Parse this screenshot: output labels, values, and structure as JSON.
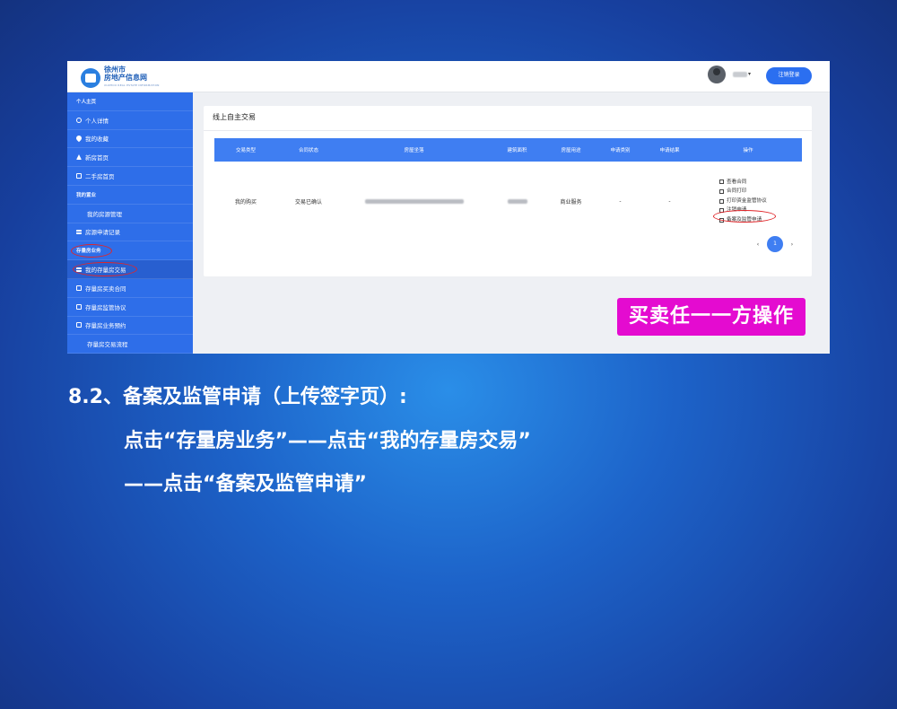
{
  "header": {
    "logo_line1": "徐州市",
    "logo_line2": "房地产信息网",
    "logo_line3": "XUZHOU REAL ESTATE INFORMATION",
    "logout_label": "注销登录"
  },
  "sidebar": {
    "items": [
      {
        "label": "个人主页",
        "type": "section"
      },
      {
        "label": "个人详情",
        "type": "item",
        "icon": "person-icon"
      },
      {
        "label": "我的收藏",
        "type": "item",
        "icon": "heart-icon"
      },
      {
        "label": "新房首页",
        "type": "item",
        "icon": "home-icon"
      },
      {
        "label": "二手房首页",
        "type": "item",
        "icon": "doc-icon"
      },
      {
        "label": "我的置业",
        "type": "section"
      },
      {
        "label": "我的房源管理",
        "type": "sub"
      },
      {
        "label": "房源申请记录",
        "type": "item",
        "icon": "list-icon"
      },
      {
        "label": "存量房业务",
        "type": "section"
      },
      {
        "label": "我的存量房交易",
        "type": "item",
        "icon": "list-icon"
      },
      {
        "label": "存量房买卖合同",
        "type": "item",
        "icon": "doc-icon"
      },
      {
        "label": "存量房监管协议",
        "type": "item",
        "icon": "doc-icon"
      },
      {
        "label": "存量房业务预约",
        "type": "item",
        "icon": "doc-icon"
      },
      {
        "label": "存量房交易流程",
        "type": "sub"
      }
    ]
  },
  "content": {
    "title": "线上自主交易",
    "columns": [
      "交易类型",
      "合同状态",
      "房屋坐落",
      "建筑面积",
      "房屋用途",
      "申请类别",
      "申请结果",
      "操作"
    ],
    "row": {
      "trade_type": "我的购买",
      "contract_status": "交易已确认",
      "usage": "商业服务",
      "apply_type": "-",
      "apply_result": "-"
    },
    "operations": [
      {
        "label": "查看合同",
        "icon": "doc-icon"
      },
      {
        "label": "合同打印",
        "icon": "printer-icon"
      },
      {
        "label": "打印资金监管协议",
        "icon": "printer-icon"
      },
      {
        "label": "注销申请",
        "icon": "trash-icon"
      },
      {
        "label": "备案及监管申请",
        "icon": "upload-icon"
      }
    ],
    "pager": {
      "prev": "‹",
      "page": "1",
      "next": "›"
    }
  },
  "banner": "买卖任一一方操作",
  "instructions": {
    "heading": "8.2、备案及监管申请（上传签字页）:",
    "line2": "点击“存量房业务”——点击“我的存量房交易”",
    "line3": "——点击“备案及监管申请”"
  },
  "colors": {
    "primary": "#2e6ee9",
    "table_header": "#3f7ef2",
    "banner": "#e40bd0",
    "highlight_oval": "#e0262a"
  }
}
